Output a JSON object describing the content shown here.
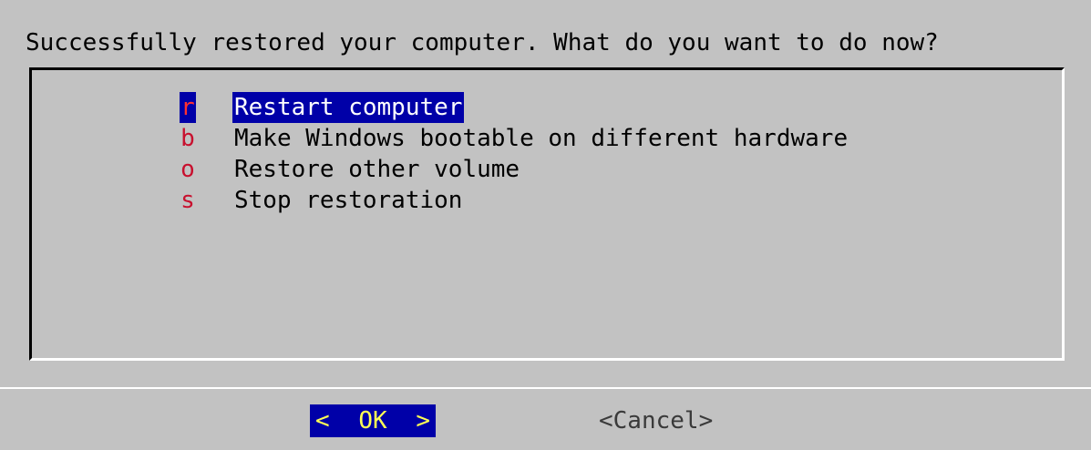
{
  "dialog": {
    "prompt": "Successfully restored your computer. What do you want to do now?"
  },
  "menu": {
    "items": [
      {
        "key": "r",
        "label": "Restart computer",
        "selected": true
      },
      {
        "key": "b",
        "label": "Make Windows bootable on different hardware",
        "selected": false
      },
      {
        "key": "o",
        "label": "Restore other volume",
        "selected": false
      },
      {
        "key": "s",
        "label": "Stop restoration",
        "selected": false
      }
    ]
  },
  "buttons": {
    "ok": {
      "left_bracket": "<",
      "label": "OK",
      "right_bracket": ">"
    },
    "cancel": "<Cancel>"
  },
  "colors": {
    "background": "#c2c2c2",
    "selection": "#0000a8",
    "hotkey": "#c8102e",
    "ok_text": "#ffff55"
  }
}
